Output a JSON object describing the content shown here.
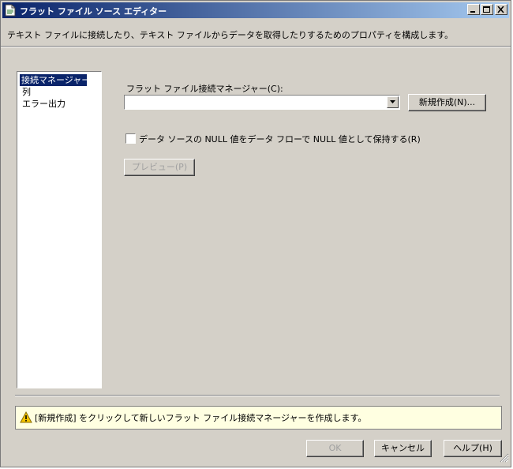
{
  "window": {
    "title": "フラット ファイル ソース エディター"
  },
  "description": "テキスト ファイルに接続したり、テキスト ファイルからデータを取得したりするためのプロパティを構成します。",
  "nav": {
    "items": [
      {
        "label": "接続マネージャー",
        "selected": true
      },
      {
        "label": "列",
        "selected": false
      },
      {
        "label": "エラー出力",
        "selected": false
      }
    ]
  },
  "connection": {
    "label": "フラット ファイル接続マネージャー(C):",
    "value": "",
    "new_button": "新規作成(N)..."
  },
  "retain_null": {
    "label": "データ ソースの NULL 値をデータ フローで NULL 値として保持する(R)",
    "checked": false
  },
  "preview_button": "プレビュー(P)",
  "message": "[新規作成] をクリックして新しいフラット ファイル接続マネージャーを作成します。",
  "footer": {
    "ok": "OK",
    "cancel": "キャンセル",
    "help": "ヘルプ(H)"
  },
  "colors": {
    "title_start": "#0a246a",
    "title_end": "#a6caf0",
    "face": "#d4d0c8",
    "selection": "#0a246a",
    "info_bar": "#ffffe1",
    "warning": "#f5c400"
  }
}
